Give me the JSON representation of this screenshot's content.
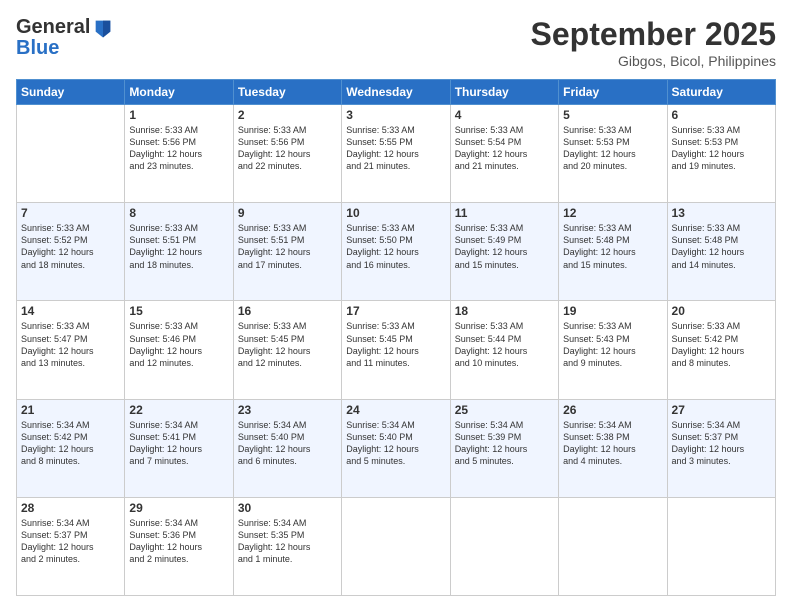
{
  "header": {
    "logo_line1": "General",
    "logo_line2": "Blue",
    "month": "September 2025",
    "location": "Gibgos, Bicol, Philippines"
  },
  "weekdays": [
    "Sunday",
    "Monday",
    "Tuesday",
    "Wednesday",
    "Thursday",
    "Friday",
    "Saturday"
  ],
  "weeks": [
    [
      {
        "day": "",
        "info": ""
      },
      {
        "day": "1",
        "info": "Sunrise: 5:33 AM\nSunset: 5:56 PM\nDaylight: 12 hours\nand 23 minutes."
      },
      {
        "day": "2",
        "info": "Sunrise: 5:33 AM\nSunset: 5:56 PM\nDaylight: 12 hours\nand 22 minutes."
      },
      {
        "day": "3",
        "info": "Sunrise: 5:33 AM\nSunset: 5:55 PM\nDaylight: 12 hours\nand 21 minutes."
      },
      {
        "day": "4",
        "info": "Sunrise: 5:33 AM\nSunset: 5:54 PM\nDaylight: 12 hours\nand 21 minutes."
      },
      {
        "day": "5",
        "info": "Sunrise: 5:33 AM\nSunset: 5:53 PM\nDaylight: 12 hours\nand 20 minutes."
      },
      {
        "day": "6",
        "info": "Sunrise: 5:33 AM\nSunset: 5:53 PM\nDaylight: 12 hours\nand 19 minutes."
      }
    ],
    [
      {
        "day": "7",
        "info": "Sunrise: 5:33 AM\nSunset: 5:52 PM\nDaylight: 12 hours\nand 18 minutes."
      },
      {
        "day": "8",
        "info": "Sunrise: 5:33 AM\nSunset: 5:51 PM\nDaylight: 12 hours\nand 18 minutes."
      },
      {
        "day": "9",
        "info": "Sunrise: 5:33 AM\nSunset: 5:51 PM\nDaylight: 12 hours\nand 17 minutes."
      },
      {
        "day": "10",
        "info": "Sunrise: 5:33 AM\nSunset: 5:50 PM\nDaylight: 12 hours\nand 16 minutes."
      },
      {
        "day": "11",
        "info": "Sunrise: 5:33 AM\nSunset: 5:49 PM\nDaylight: 12 hours\nand 15 minutes."
      },
      {
        "day": "12",
        "info": "Sunrise: 5:33 AM\nSunset: 5:48 PM\nDaylight: 12 hours\nand 15 minutes."
      },
      {
        "day": "13",
        "info": "Sunrise: 5:33 AM\nSunset: 5:48 PM\nDaylight: 12 hours\nand 14 minutes."
      }
    ],
    [
      {
        "day": "14",
        "info": "Sunrise: 5:33 AM\nSunset: 5:47 PM\nDaylight: 12 hours\nand 13 minutes."
      },
      {
        "day": "15",
        "info": "Sunrise: 5:33 AM\nSunset: 5:46 PM\nDaylight: 12 hours\nand 12 minutes."
      },
      {
        "day": "16",
        "info": "Sunrise: 5:33 AM\nSunset: 5:45 PM\nDaylight: 12 hours\nand 12 minutes."
      },
      {
        "day": "17",
        "info": "Sunrise: 5:33 AM\nSunset: 5:45 PM\nDaylight: 12 hours\nand 11 minutes."
      },
      {
        "day": "18",
        "info": "Sunrise: 5:33 AM\nSunset: 5:44 PM\nDaylight: 12 hours\nand 10 minutes."
      },
      {
        "day": "19",
        "info": "Sunrise: 5:33 AM\nSunset: 5:43 PM\nDaylight: 12 hours\nand 9 minutes."
      },
      {
        "day": "20",
        "info": "Sunrise: 5:33 AM\nSunset: 5:42 PM\nDaylight: 12 hours\nand 8 minutes."
      }
    ],
    [
      {
        "day": "21",
        "info": "Sunrise: 5:34 AM\nSunset: 5:42 PM\nDaylight: 12 hours\nand 8 minutes."
      },
      {
        "day": "22",
        "info": "Sunrise: 5:34 AM\nSunset: 5:41 PM\nDaylight: 12 hours\nand 7 minutes."
      },
      {
        "day": "23",
        "info": "Sunrise: 5:34 AM\nSunset: 5:40 PM\nDaylight: 12 hours\nand 6 minutes."
      },
      {
        "day": "24",
        "info": "Sunrise: 5:34 AM\nSunset: 5:40 PM\nDaylight: 12 hours\nand 5 minutes."
      },
      {
        "day": "25",
        "info": "Sunrise: 5:34 AM\nSunset: 5:39 PM\nDaylight: 12 hours\nand 5 minutes."
      },
      {
        "day": "26",
        "info": "Sunrise: 5:34 AM\nSunset: 5:38 PM\nDaylight: 12 hours\nand 4 minutes."
      },
      {
        "day": "27",
        "info": "Sunrise: 5:34 AM\nSunset: 5:37 PM\nDaylight: 12 hours\nand 3 minutes."
      }
    ],
    [
      {
        "day": "28",
        "info": "Sunrise: 5:34 AM\nSunset: 5:37 PM\nDaylight: 12 hours\nand 2 minutes."
      },
      {
        "day": "29",
        "info": "Sunrise: 5:34 AM\nSunset: 5:36 PM\nDaylight: 12 hours\nand 2 minutes."
      },
      {
        "day": "30",
        "info": "Sunrise: 5:34 AM\nSunset: 5:35 PM\nDaylight: 12 hours\nand 1 minute."
      },
      {
        "day": "",
        "info": ""
      },
      {
        "day": "",
        "info": ""
      },
      {
        "day": "",
        "info": ""
      },
      {
        "day": "",
        "info": ""
      }
    ]
  ]
}
